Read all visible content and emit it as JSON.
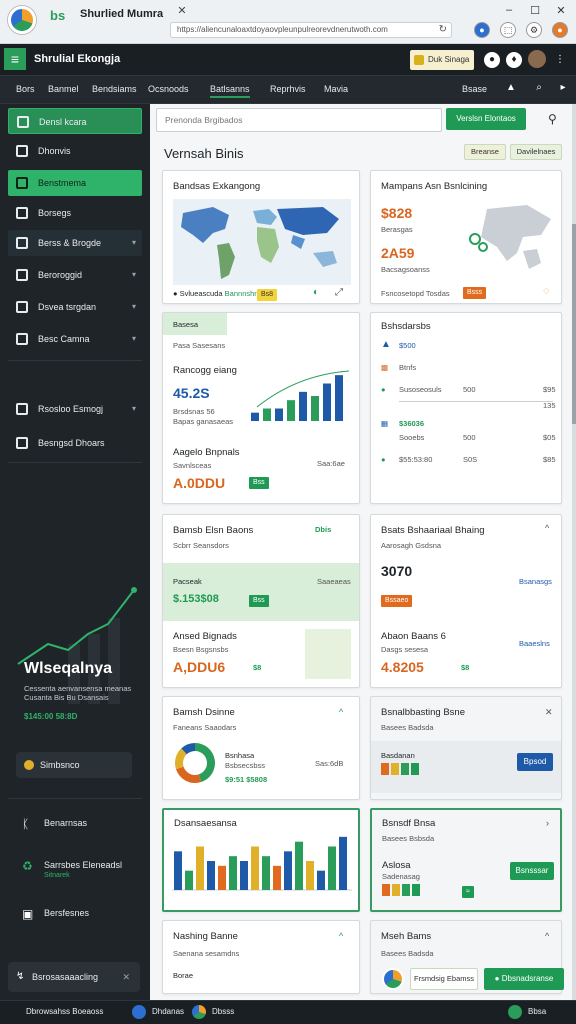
{
  "browser": {
    "tab_title": "Shurlied Mumra",
    "tab_logo": "bs",
    "url": "https://aliencunaloaxtdoyaovpleunpulreorevdnerutwoth.com",
    "icons": [
      "reload-icon",
      "minimize-icon",
      "maximize-icon",
      "close-icon",
      "chrome-icon",
      "extension-icon",
      "settings-icon",
      "profile-icon"
    ]
  },
  "header": {
    "title": "Shrulial Ekongja",
    "menu_icon": "≡",
    "badge": "Duk Sinaga"
  },
  "top_nav": {
    "items": [
      "Bors",
      "Banmel",
      "Bendsiams",
      "Ocsnoods",
      "Batlsanns",
      "Reprhvis",
      "Mavia"
    ],
    "active_index": 4,
    "right_label": "Bsase"
  },
  "sidebar": {
    "items": [
      {
        "label": "Densl kcara",
        "style": "outline"
      },
      {
        "label": "Dhonvis",
        "style": "plain"
      },
      {
        "label": "Benstmema",
        "style": "green"
      },
      {
        "label": "Borsegs",
        "style": "plain"
      },
      {
        "label": "Berss & Brogde",
        "style": "chevron"
      },
      {
        "label": "Beroroggid",
        "style": "chevron"
      },
      {
        "label": "Dsvea tsrgdan",
        "style": "chevron"
      },
      {
        "label": "Besc Camna",
        "style": "chevron"
      },
      {
        "label": "Rsosloo Esmogj",
        "style": "chevron"
      },
      {
        "label": "Besngsd Dhoars",
        "style": "plain"
      }
    ],
    "promo": {
      "title": "Wlseqalnya",
      "subtitle": "Cessenta aenvansensa meanas Cusanta Bis Bu Dsansais",
      "code": "$145:00 58:8D"
    },
    "pill": "Simbsnco",
    "links": [
      {
        "label": "Benarnsas",
        "sub": ""
      },
      {
        "label": "Sarrsbes Eleneadsl",
        "sub": "Sitnarek"
      },
      {
        "label": "Bersfesnes",
        "sub": ""
      }
    ],
    "footer": "Bsrosasaaacling",
    "footer_icon": "↯"
  },
  "main": {
    "search_placeholder": "Prenonda Brgibados",
    "search_button": "Verslsn Elontaos",
    "title": "Vernsah Binis",
    "filter_buttons": [
      "Breanse",
      "Davilelnaes"
    ],
    "cards": {
      "map1": {
        "title": "Bandsas Exkangong",
        "legend": "Svlueascuda",
        "legend2": "Bannnshro",
        "tag": "Bs8"
      },
      "map2": {
        "title": "Mampans Asn Bsnlcining",
        "n1": "$828",
        "n1_label": "Berasgas",
        "n2": "2A59",
        "n2_label": "Bacsagsoanss",
        "footer": "Fsncosetopd Tosdas",
        "tag": "Bsss"
      },
      "growth": {
        "tab": "Basesa",
        "sub": "Pasa Sasesans",
        "title": "Rancogg eiang",
        "value": "45.2S",
        "l1": "Brsdsnas 56",
        "l2": "Bapas ganasaeas",
        "t2": "Aagelo Bnpnals",
        "s2": "Savnlsceas",
        "value2": "A.0DDU",
        "right": "Saa:6ae",
        "tag": "Bss"
      },
      "list": {
        "title": "Bshsdarsbs",
        "rows": [
          {
            "label": "$500",
            "c1": "",
            "c2": ""
          },
          {
            "label": "Btnfs",
            "c1": "",
            "c2": ""
          },
          {
            "label": "Susoseosuls",
            "c1": "500",
            "c2": "$95"
          },
          {
            "label": "$36036",
            "c1": "",
            "c2": "135"
          },
          {
            "label": "Sooebs",
            "c1": "500",
            "c2": "$05"
          },
          {
            "label": "$55:53:80",
            "c1": "S0S",
            "c2": "$85"
          }
        ]
      },
      "sales": {
        "title": "Bamsb Elsn Baons",
        "tag": "Dbis",
        "sub": "Scbrr Seansdors",
        "row1": "Pacseak",
        "row1r": "Saaeaeas",
        "value1": "$.153$08",
        "tag1": "Bss",
        "t2": "Ansed Bignads",
        "s2": "Bsesn Bsgsnsbs",
        "value2": "A,DDU6",
        "r2": "$8"
      },
      "stats": {
        "title": "Bsats Bshaariaal Bhaing",
        "big": "3070",
        "sub": "Aarosagh Gsdsna",
        "right": "Bsanasgs",
        "tag": "Bssaeo",
        "t2": "Abaon Baans 6",
        "s2": "Dasgs sesesa",
        "r2": "Baaeslns",
        "value2": "4.8205",
        "r3": "$8"
      },
      "donut": {
        "title": "Bamsh Dsinne",
        "sub": "Faneans Saaodars",
        "legend": "Bsnhasa",
        "legend_sub": "Bsbsecsbss",
        "right": "Sas:6dB",
        "value": "$9:51 $5808"
      },
      "rec": {
        "title": "Bsnalbbasting Bsne",
        "sub": "Basees Badsda",
        "legend": "Basdanan",
        "button": "Bpsod"
      },
      "bars": {
        "title": "Dsansaesansa"
      },
      "rec2": {
        "title": "Bsnsdf Bnsa",
        "sub": "Basees Bsbsda",
        "t2": "Aslosa",
        "s2": "Sadenasag",
        "button": "Bsnsssar"
      },
      "bottom1": {
        "title": "Nashing Banne",
        "sub": "Saenana sesamdns",
        "row": "Borae"
      },
      "bottom2": {
        "title": "Mseh Bams",
        "sub": "Basees Badsda"
      }
    },
    "bottom_buttons": [
      "Frsmdsig Ebamss",
      "Dbsnadsranse"
    ]
  },
  "taskbar": {
    "items": [
      "Dbrowsahss Boeaoss",
      "Dhdanas",
      "Dbsss"
    ],
    "right": "Bbsa"
  },
  "chart_data": [
    {
      "type": "bar",
      "title": "Rancogg eiang",
      "categories": [
        "1",
        "2",
        "3",
        "4",
        "5",
        "6",
        "7",
        "8"
      ],
      "series": [
        {
          "values": [
            2,
            3,
            3,
            5,
            7,
            6,
            9,
            11
          ]
        }
      ]
    },
    {
      "type": "bar",
      "title": "Dsansaesansa",
      "categories": [
        "1",
        "2",
        "3",
        "4",
        "5",
        "6",
        "7",
        "8",
        "9",
        "10",
        "11",
        "12",
        "13",
        "14",
        "15",
        "16"
      ],
      "series": [
        {
          "values": [
            8,
            4,
            9,
            6,
            5,
            7,
            6,
            9,
            7,
            5,
            8,
            10,
            6,
            4,
            9,
            11
          ]
        }
      ]
    },
    {
      "type": "pie",
      "title": "Bamsh Dsinne",
      "categories": [
        "a",
        "b",
        "c",
        "d"
      ],
      "values": [
        45,
        25,
        18,
        12
      ]
    }
  ],
  "colors": {
    "accent": "#1f9a55",
    "orange": "#d9661f",
    "blue": "#1e5aa8",
    "dark": "#1e2428"
  }
}
